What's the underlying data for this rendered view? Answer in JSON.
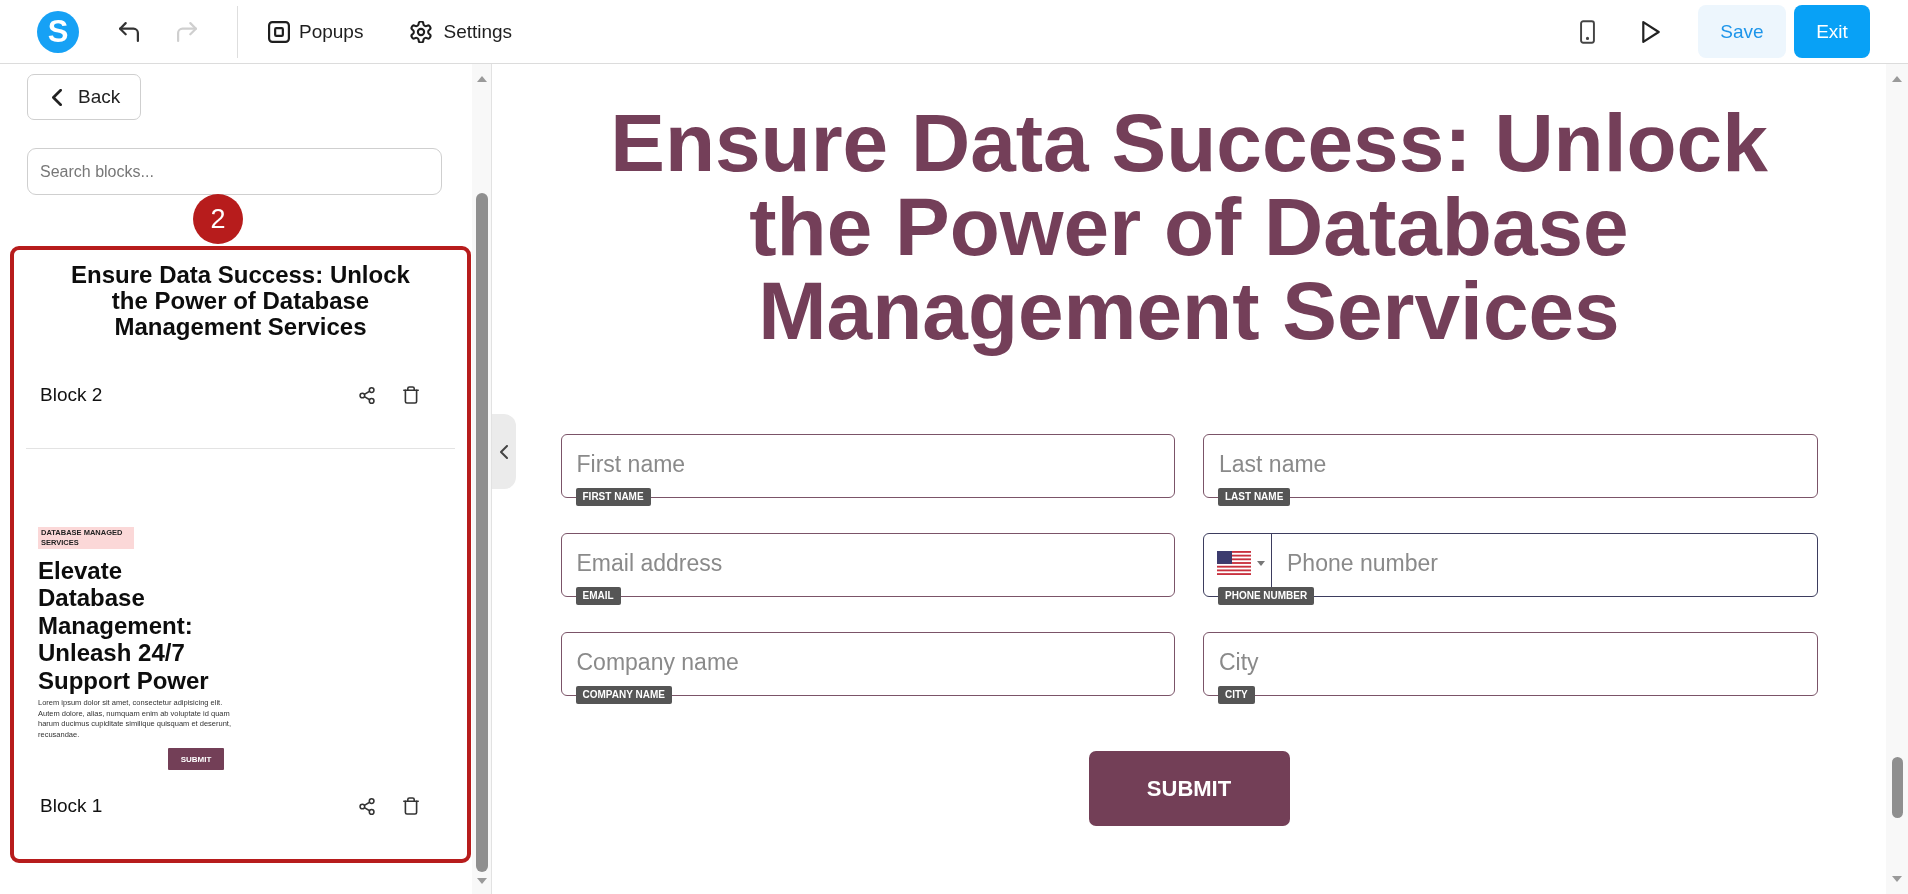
{
  "toolbar": {
    "logo": "S",
    "undo": {
      "disabled": false
    },
    "redo": {
      "disabled": true
    },
    "popups": {
      "label": "Popups"
    },
    "settings": {
      "label": "Settings"
    },
    "save": {
      "label": "Save"
    },
    "exit": {
      "label": "Exit"
    }
  },
  "sidebar": {
    "back": {
      "label": "Back"
    },
    "search": {
      "placeholder": "Search blocks..."
    },
    "annotation": {
      "number": "2"
    },
    "blocks": [
      {
        "kind": "heading",
        "name": "Block 2",
        "preview": {
          "heading": "Ensure Data Success: Unlock the Power of Database Management Services"
        }
      },
      {
        "kind": "hero",
        "name": "Block 1",
        "preview": {
          "tag": "DATABASE MANAGED SERVICES",
          "heading": "Elevate Database Management: Unleash 24/7 Support Power",
          "body": "Lorem ipsum dolor sit amet, consectetur adipisicing elit. Autem dolore, alias, numquam enim ab voluptate id quam harum ducimus cupiditate similique quisquam et deserunt, recusandae.",
          "button": "SUBMIT"
        }
      }
    ]
  },
  "canvas": {
    "heading": "Ensure Data Success: Unlock the Power of Database Management Services",
    "fields": [
      {
        "kind": "text",
        "placeholder": "First name",
        "label": "FIRST NAME"
      },
      {
        "kind": "text",
        "placeholder": "Last name",
        "label": "LAST NAME"
      },
      {
        "kind": "text",
        "placeholder": "Email address",
        "label": "EMAIL"
      },
      {
        "kind": "phone",
        "placeholder": "Phone number",
        "label": "PHONE NUMBER"
      },
      {
        "kind": "text",
        "placeholder": "Company name",
        "label": "COMPANY NAME"
      },
      {
        "kind": "text",
        "placeholder": "City",
        "label": "CITY"
      }
    ],
    "submit": "SUBMIT"
  }
}
